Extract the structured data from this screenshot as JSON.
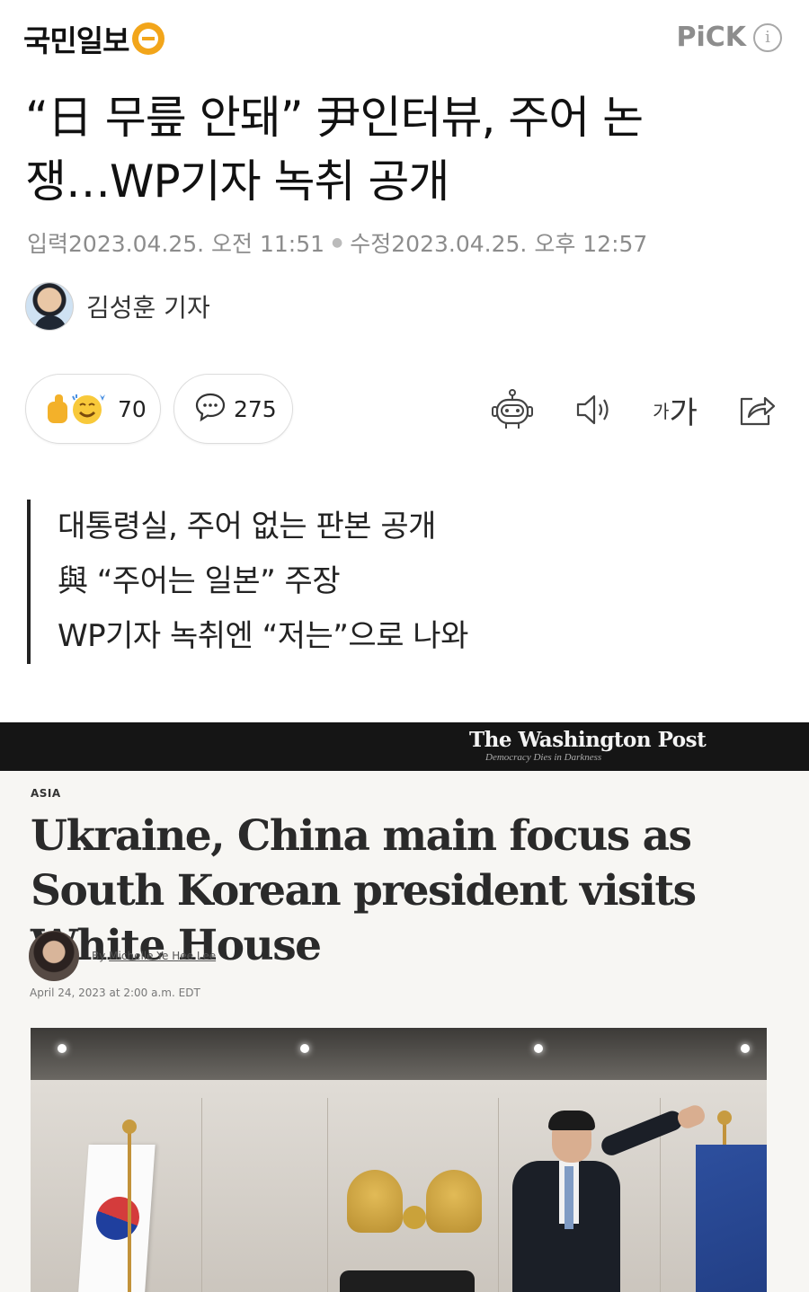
{
  "header": {
    "logo_text": "국민일보",
    "pick_label": "PiCK",
    "info_icon": "info-icon",
    "info_glyph": "i"
  },
  "article": {
    "headline_line1": "“日 무릎 안돼” 尹인터뷰, 주어 논",
    "headline_line2": "쟁…WP기자 녹취 공개",
    "published_label": "입력",
    "published_at": "2023.04.25. 오전 11:51",
    "modified_label": "수정",
    "modified_at": "2023.04.25. 오후 12:57",
    "reporter": "김성훈 기자"
  },
  "actions": {
    "reaction_count": "70",
    "comment_count": "275",
    "font_size_small": "가",
    "font_size_large": "가",
    "icons": [
      "robot-summary-icon",
      "speaker-icon",
      "font-size-icon",
      "share-icon"
    ]
  },
  "summary": [
    "대통령실, 주어 없는 판본 공개",
    "與 “주어는 일본” 주장",
    "WP기자 녹취엔 “저는”으로 나와"
  ],
  "embed": {
    "wp_logo": "The Washington Post",
    "wp_tagline": "Democracy Dies in Darkness",
    "section": "ASIA",
    "headline": "Ukraine, China main focus as South Korean president visits White House",
    "by": "By",
    "author": "Michelle Ye Hee Lee",
    "date": "April 24, 2023 at 2:00 a.m. EDT"
  },
  "colors": {
    "logo_accent": "#f2a51a",
    "wp_bar": "#151515",
    "summary_rule": "#222222"
  }
}
